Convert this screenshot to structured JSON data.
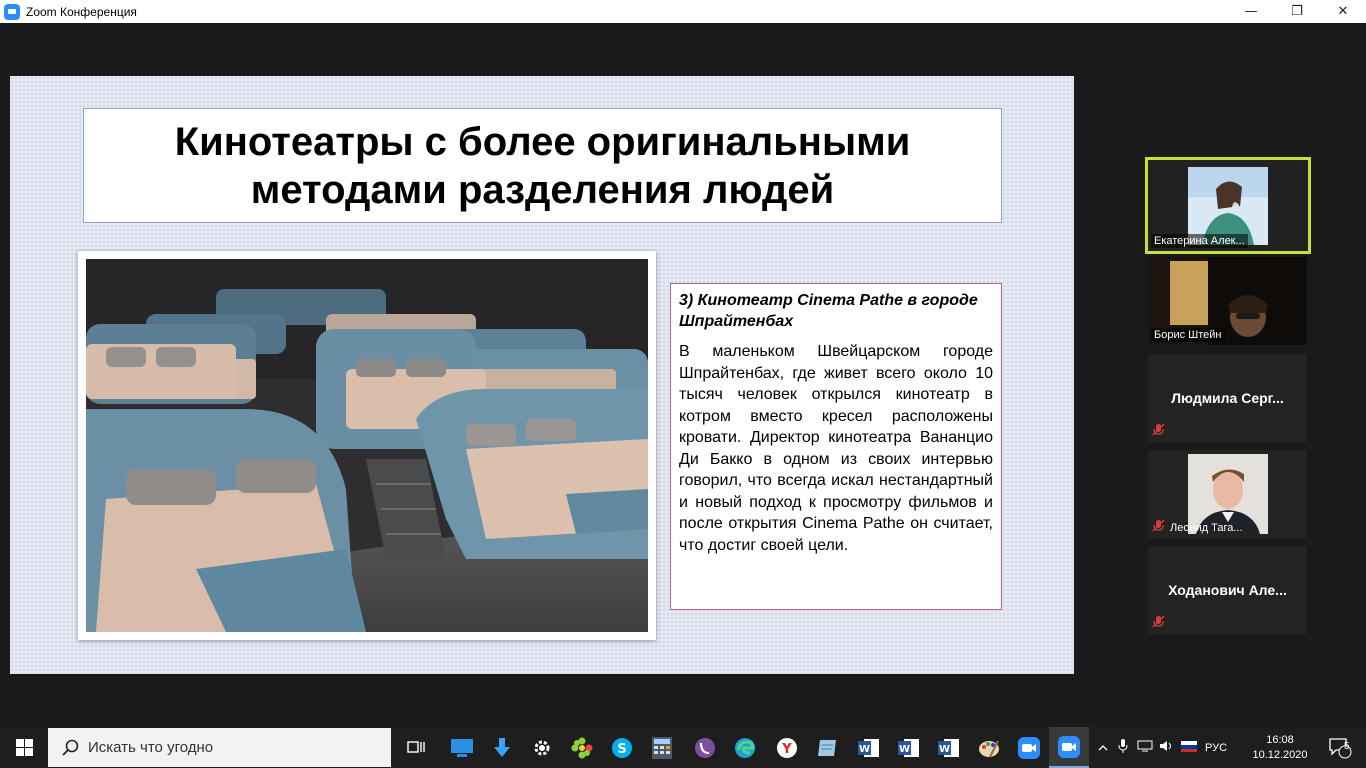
{
  "window": {
    "title": "Zoom Конференция",
    "controls": {
      "minimize": "—",
      "restore": "❐",
      "close": "✕"
    }
  },
  "slide": {
    "title": "Кинотеатры с более оригинальными методами разделения людей",
    "heading": "3) Кинотеатр Cinema Pathe в городе Шпрайтенбах",
    "body": "В маленьком Швейцарском городе Шпрайтенбах, где живет всего около 10 тысяч человек открылся кинотеатр в котром вместо кресел расположены кровати. Директор кинотеатра Вананцио Ди Бакко в одном из своих интервью говорил, что всегда искал нестандартный и новый подход к просмотру фильмов и после открытия  Cinema Pathe он считает, что достиг своей цели."
  },
  "participants": [
    {
      "name": "Екатерина Алек...",
      "video": true,
      "active": true,
      "muted": false
    },
    {
      "name": "Борис Штейн",
      "video": true,
      "active": false,
      "muted": false
    },
    {
      "name": "Людмила  Серг...",
      "video": false,
      "active": false,
      "muted": true
    },
    {
      "name": "Леонид Тага...",
      "video": true,
      "active": false,
      "muted": true
    },
    {
      "name": "Ходанович  Але...",
      "video": false,
      "active": false,
      "muted": true
    }
  ],
  "taskbar": {
    "search_placeholder": "Искать что угодно",
    "apps": [
      "task-view",
      "desktop",
      "downloads",
      "settings",
      "icq",
      "skype",
      "calculator",
      "viber",
      "edge",
      "yandex",
      "notes",
      "word",
      "word",
      "word",
      "paint",
      "zoom",
      "zoom"
    ],
    "language": "РУС",
    "time": "16:08",
    "date": "10.12.2020",
    "notifications_count": "5"
  },
  "colors": {
    "active_speaker_border": "#c6e135",
    "text_box_border": "#c06090",
    "title_box_border": "#8fa3c4",
    "zoom_blue": "#2d8cff"
  }
}
